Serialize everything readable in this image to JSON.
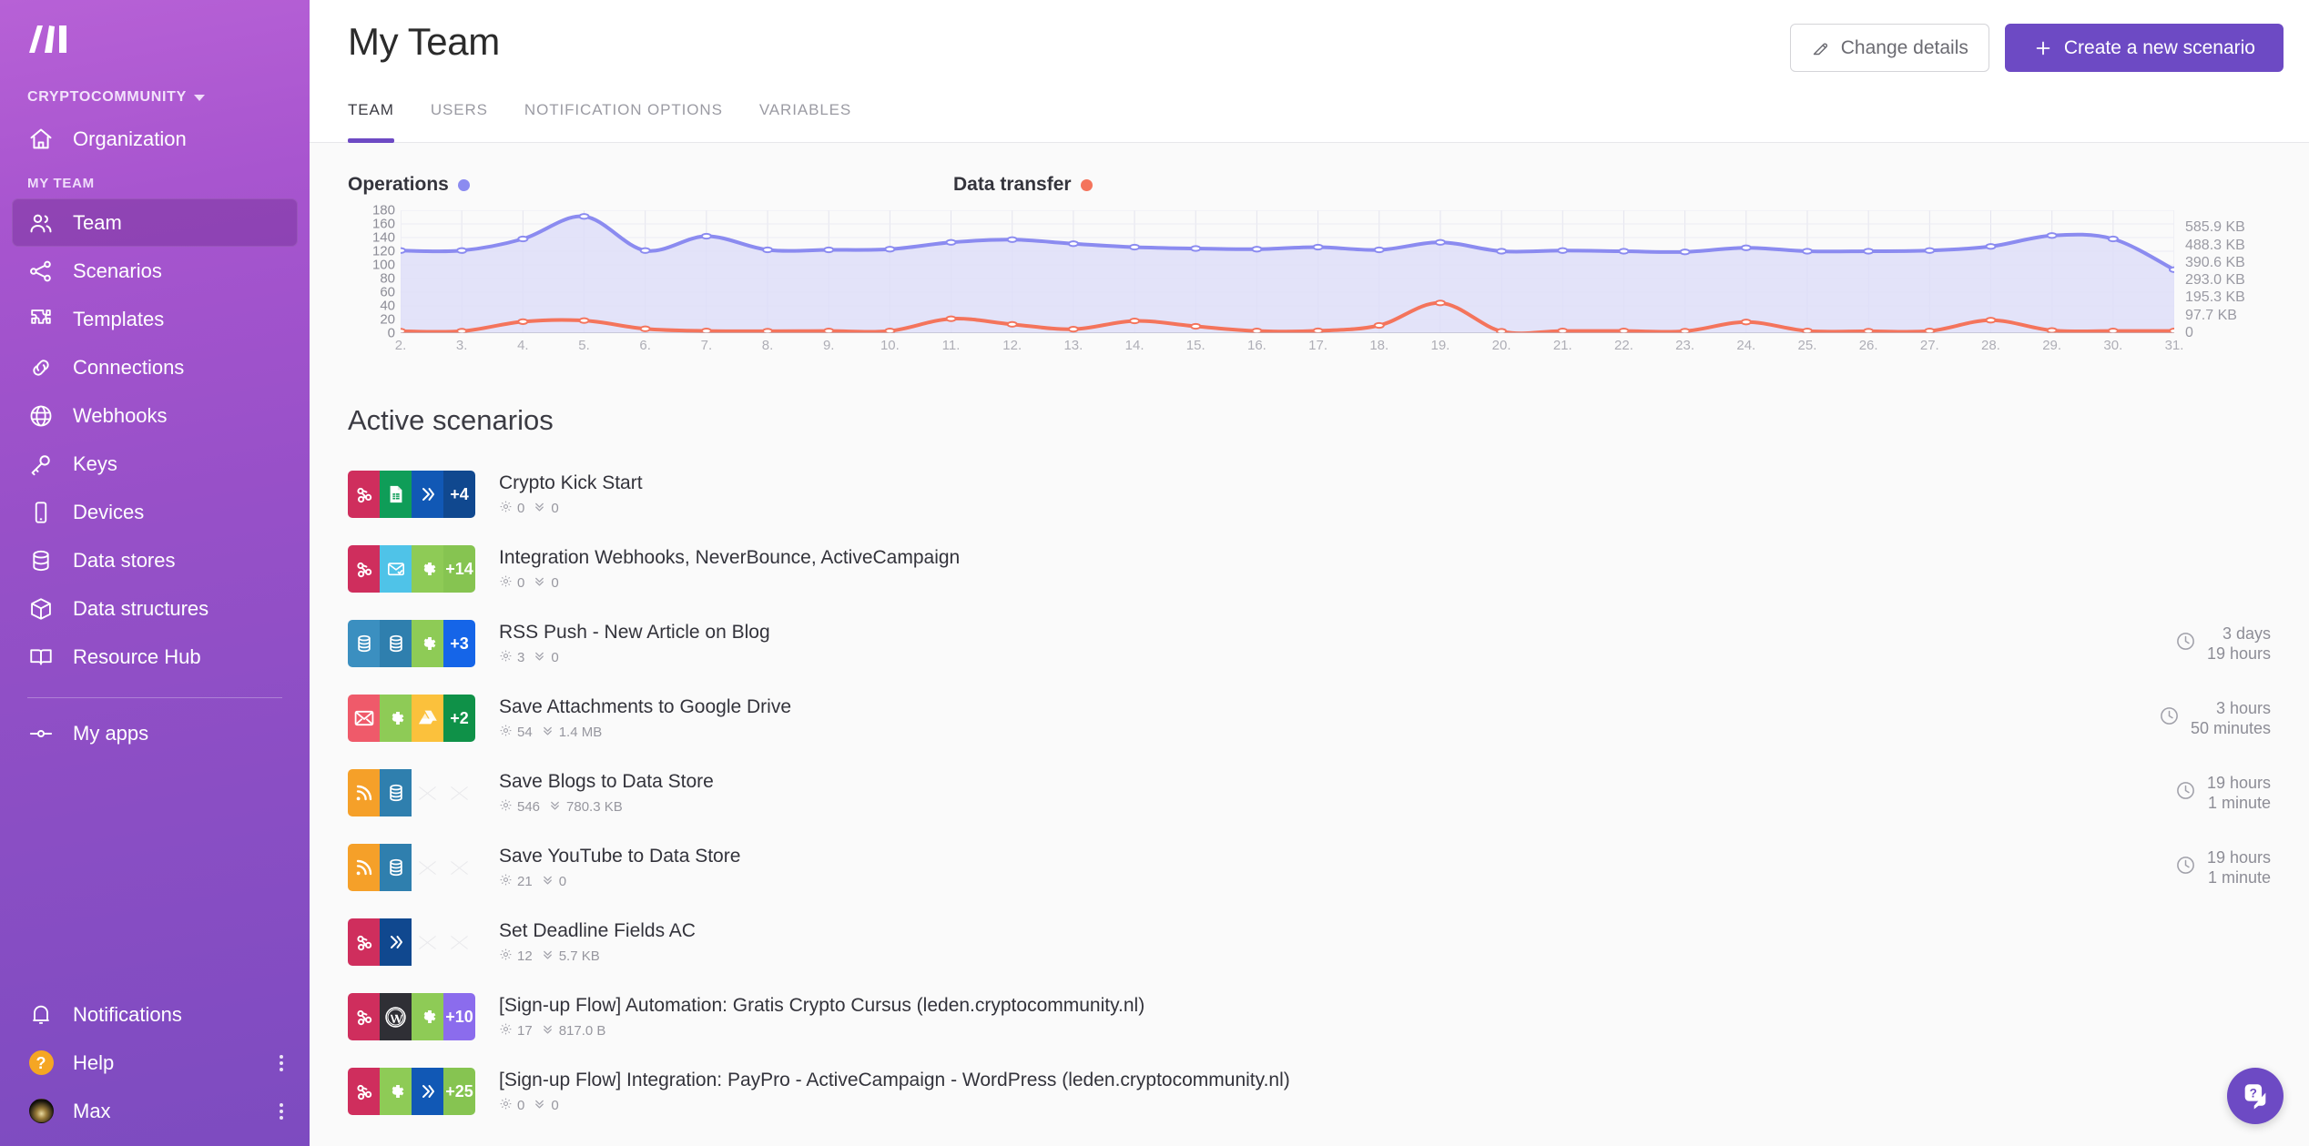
{
  "sidebar": {
    "logo_icon": "make-logo-icon",
    "org": {
      "name": "CRYPTOCOMMUNITY",
      "caret_icon": "chevron-down-icon"
    },
    "org_items": [
      {
        "label": "Organization",
        "icon": "home-icon"
      }
    ],
    "section_label": "MY TEAM",
    "items": [
      {
        "label": "Team",
        "icon": "users-icon",
        "active": true
      },
      {
        "label": "Scenarios",
        "icon": "share-nodes-icon",
        "active": false
      },
      {
        "label": "Templates",
        "icon": "puzzle-icon",
        "active": false
      },
      {
        "label": "Connections",
        "icon": "link-icon",
        "active": false
      },
      {
        "label": "Webhooks",
        "icon": "globe-icon",
        "active": false
      },
      {
        "label": "Keys",
        "icon": "key-icon",
        "active": false
      },
      {
        "label": "Devices",
        "icon": "device-icon",
        "active": false
      },
      {
        "label": "Data stores",
        "icon": "database-icon",
        "active": false
      },
      {
        "label": "Data structures",
        "icon": "cube-icon",
        "active": false
      },
      {
        "label": "Resource Hub",
        "icon": "book-icon",
        "active": false
      }
    ],
    "apps_item": {
      "label": "My apps",
      "icon": "apps-node-icon"
    },
    "bottom_items": [
      {
        "label": "Notifications",
        "icon": "bell-icon",
        "has_menu": false
      },
      {
        "label": "Help",
        "icon": "help-circle-icon",
        "has_menu": true
      },
      {
        "label": "Max",
        "icon": "user-avatar",
        "has_menu": true
      }
    ]
  },
  "header": {
    "title": "My Team",
    "change_details_label": "Change details",
    "change_details_icon": "edit-pencil-icon",
    "create_scenario_label": "Create a new scenario",
    "create_scenario_icon": "plus-icon"
  },
  "tabs": [
    {
      "label": "TEAM",
      "active": true
    },
    {
      "label": "USERS",
      "active": false
    },
    {
      "label": "NOTIFICATION OPTIONS",
      "active": false
    },
    {
      "label": "VARIABLES",
      "active": false
    }
  ],
  "chart_data": {
    "type": "line",
    "title": "",
    "legend_position": "top",
    "grid": true,
    "x": [
      "2.",
      "3.",
      "4.",
      "5.",
      "6.",
      "7.",
      "8.",
      "9.",
      "10.",
      "11.",
      "12.",
      "13.",
      "14.",
      "15.",
      "16.",
      "17.",
      "18.",
      "19.",
      "20.",
      "21.",
      "22.",
      "23.",
      "24.",
      "25.",
      "26.",
      "27.",
      "28.",
      "29.",
      "30.",
      "31."
    ],
    "xlabel": "",
    "axes": [
      {
        "id": "operations",
        "side": "left",
        "label": "Operations",
        "color": "#8b8bf0",
        "ylim": [
          0,
          180
        ],
        "ticks": [
          180,
          160,
          140,
          120,
          100,
          80,
          60,
          40,
          20,
          0
        ],
        "tick_labels": [
          "180",
          "160",
          "140",
          "120",
          "100",
          "80",
          "60",
          "40",
          "20",
          "0"
        ]
      },
      {
        "id": "data_transfer",
        "side": "right",
        "label": "Data transfer",
        "color": "#f4745c",
        "ylim": [
          0,
          683.6
        ],
        "ticks": [
          585.9,
          488.3,
          390.6,
          293.0,
          195.3,
          97.7,
          0
        ],
        "tick_labels": [
          "585.9 KB",
          "488.3 KB",
          "390.6 KB",
          "293.0 KB",
          "195.3 KB",
          "97.7 KB",
          "0"
        ]
      }
    ],
    "series": [
      {
        "name": "Operations",
        "axis": "operations",
        "color": "#8b8bf0",
        "fill": "#dedef8",
        "values": [
          121,
          121,
          138,
          171,
          121,
          142,
          122,
          122,
          123,
          133,
          137,
          131,
          126,
          124,
          123,
          126,
          122,
          133,
          120,
          121,
          120,
          119,
          125,
          120,
          120,
          121,
          127,
          143,
          138,
          93
        ]
      },
      {
        "name": "Data transfer",
        "axis": "data_transfer",
        "color": "#f4745c",
        "fill": "none",
        "values": [
          11,
          11,
          64,
          70,
          24,
          12,
          11,
          12,
          12,
          80,
          49,
          22,
          68,
          38,
          12,
          13,
          43,
          168,
          10,
          12,
          12,
          11,
          62,
          12,
          11,
          12,
          72,
          15,
          12,
          12
        ]
      }
    ]
  },
  "scenarios": {
    "title": "Active scenarios",
    "stat_icons": {
      "operations": "gear-icon",
      "transfer": "chevrons-down-icon",
      "time": "clock-icon"
    },
    "items": [
      {
        "name": "Crypto Kick Start",
        "operations": "0",
        "transfer": "0",
        "time": null,
        "tiles": [
          {
            "icon": "webhook-icon",
            "color": "#cf2e5d"
          },
          {
            "icon": "google-sheets-icon",
            "color": "#0f9d58"
          },
          {
            "icon": "chevrons-right-icon",
            "color": "#1158b5"
          },
          {
            "icon": "more-count",
            "color": "#10488f",
            "label": "+4"
          }
        ]
      },
      {
        "name": "Integration Webhooks, NeverBounce, ActiveCampaign",
        "operations": "0",
        "transfer": "0",
        "time": null,
        "tiles": [
          {
            "icon": "webhook-icon",
            "color": "#cf2e5d"
          },
          {
            "icon": "mail-check-icon",
            "color": "#4fc3e8"
          },
          {
            "icon": "gear-icon",
            "color": "#8ecb56"
          },
          {
            "icon": "more-count",
            "color": "#86c451",
            "label": "+14"
          }
        ]
      },
      {
        "name": "RSS Push - New Article on Blog",
        "operations": "3",
        "transfer": "0",
        "time": {
          "line1": "3 days",
          "line2": "19 hours"
        },
        "tiles": [
          {
            "icon": "database-icon",
            "color": "#3b8fc0"
          },
          {
            "icon": "database-icon",
            "color": "#2f7fae"
          },
          {
            "icon": "gear-icon",
            "color": "#8ecb56"
          },
          {
            "icon": "more-count",
            "color": "#1565e8",
            "label": "+3"
          }
        ]
      },
      {
        "name": "Save Attachments to Google Drive",
        "operations": "54",
        "transfer": "1.4 MB",
        "time": {
          "line1": "3 hours",
          "line2": "50 minutes"
        },
        "tiles": [
          {
            "icon": "envelope-icon",
            "color": "#ef5a6a"
          },
          {
            "icon": "gear-icon",
            "color": "#8ecb56"
          },
          {
            "icon": "google-drive-icon",
            "color": "#fbc13c"
          },
          {
            "icon": "more-count",
            "color": "#0f9148",
            "label": "+2"
          }
        ]
      },
      {
        "name": "Save Blogs to Data Store",
        "operations": "546",
        "transfer": "780.3 KB",
        "time": {
          "line1": "19 hours",
          "line2": "1 minute"
        },
        "tiles": [
          {
            "icon": "rss-icon",
            "color": "#f5a029"
          },
          {
            "icon": "database-icon",
            "color": "#2f7fae"
          },
          {
            "icon": "empty",
            "color": "#fafafa"
          },
          {
            "icon": "empty",
            "color": "#fafafa"
          }
        ]
      },
      {
        "name": "Save YouTube to Data Store",
        "operations": "21",
        "transfer": "0",
        "time": {
          "line1": "19 hours",
          "line2": "1 minute"
        },
        "tiles": [
          {
            "icon": "rss-icon",
            "color": "#f5a029"
          },
          {
            "icon": "database-icon",
            "color": "#2f7fae"
          },
          {
            "icon": "empty",
            "color": "#fafafa"
          },
          {
            "icon": "empty",
            "color": "#fafafa"
          }
        ]
      },
      {
        "name": "Set Deadline Fields AC",
        "operations": "12",
        "transfer": "5.7 KB",
        "time": null,
        "tiles": [
          {
            "icon": "webhook-icon",
            "color": "#cf2e5d"
          },
          {
            "icon": "chevrons-right-icon",
            "color": "#10488f"
          },
          {
            "icon": "empty",
            "color": "#fafafa"
          },
          {
            "icon": "empty",
            "color": "#fafafa"
          }
        ]
      },
      {
        "name": "[Sign-up Flow] Automation: Gratis Crypto Cursus (leden.cryptocommunity.nl)",
        "operations": "17",
        "transfer": "817.0 B",
        "time": null,
        "tiles": [
          {
            "icon": "webhook-icon",
            "color": "#cf2e5d"
          },
          {
            "icon": "wordpress-icon",
            "color": "#2f2f35"
          },
          {
            "icon": "gear-icon",
            "color": "#8ecb56"
          },
          {
            "icon": "more-count",
            "color": "#8b6ced",
            "label": "+10"
          }
        ]
      },
      {
        "name": "[Sign-up Flow] Integration: PayPro - ActiveCampaign - WordPress (leden.cryptocommunity.nl)",
        "operations": "0",
        "transfer": "0",
        "time": null,
        "tiles": [
          {
            "icon": "webhook-icon",
            "color": "#cf2e5d"
          },
          {
            "icon": "gear-icon",
            "color": "#8ecb56"
          },
          {
            "icon": "chevrons-right-icon",
            "color": "#1158b5"
          },
          {
            "icon": "more-count",
            "color": "#86c451",
            "label": "+25"
          }
        ]
      }
    ]
  },
  "chat_fab": {
    "icon": "help-chat-icon",
    "color": "#6d4ac4"
  }
}
